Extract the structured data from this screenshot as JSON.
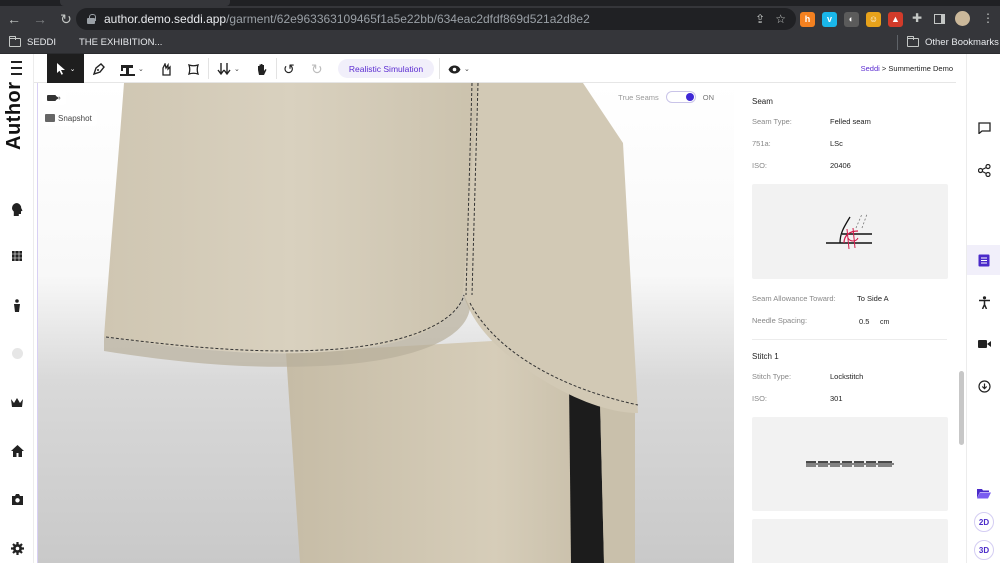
{
  "browser": {
    "url_host": "author.demo.seddi.app",
    "url_path": "/garment/62e963363109465f1a5e22bb/634eac2dfdf869d521a2d8e2",
    "bookmarks": [
      {
        "label": "SEDDI"
      },
      {
        "label": "THE EXHIBITION..."
      }
    ],
    "other_bookmarks": "Other Bookmarks",
    "extensions": [
      {
        "name": "hacker-news-icon",
        "glyph": "h",
        "color": "#f48120"
      },
      {
        "name": "vimeo-icon",
        "glyph": "v",
        "color": "#1ab7ea"
      },
      {
        "name": "dark-reader-icon",
        "glyph": "◐",
        "color": "#5b5b5b"
      },
      {
        "name": "honey-icon",
        "glyph": "☺",
        "color": "#e7a21b"
      },
      {
        "name": "badge-extension-icon",
        "glyph": "▲",
        "color": "#d23b2a"
      }
    ]
  },
  "app": {
    "brand": "Author",
    "breadcrumb": {
      "root": "Seddi",
      "separator": ">",
      "current": "Summertime Demo"
    },
    "toolbar": {
      "simulation_label": "Realistic Simulation"
    },
    "viewport": {
      "snapshot_label": "Snapshot",
      "true_seams_label": "True Seams",
      "toggle_state": "ON"
    },
    "panel": {
      "seam": {
        "title": "Seam",
        "seam_type_label": "Seam Type:",
        "seam_type_value": "Felled seam",
        "code751a_label": "751a:",
        "code751a_value": "LSc",
        "iso_label": "ISO:",
        "iso_value": "20406",
        "allowance_label": "Seam Allowance Toward:",
        "allowance_value": "To Side A",
        "needle_label": "Needle Spacing:",
        "needle_value": "0.5",
        "needle_unit": "cm"
      },
      "stitch": {
        "title": "Stitch 1",
        "type_label": "Stitch Type:",
        "type_value": "Lockstitch",
        "iso_label": "ISO:",
        "iso_value": "301"
      }
    },
    "rail": {
      "view_2d": "2D",
      "view_3d": "3D"
    }
  },
  "colors": {
    "accent": "#5b2bd1",
    "toggle_on": "#3f28d6",
    "fabric": "#d7cfbd",
    "fabric_shadow": "#b9b09c",
    "stripe": "#1c1c1c"
  }
}
